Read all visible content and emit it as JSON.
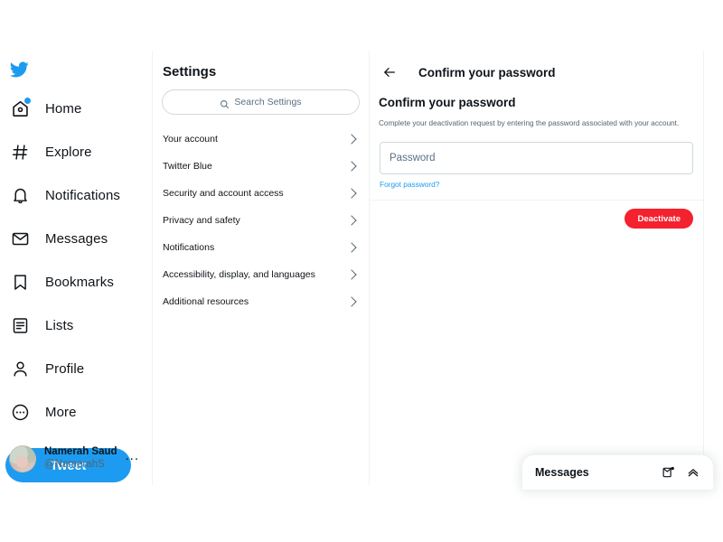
{
  "sidebar": {
    "logo_icon": "twitter-bird-icon",
    "items": [
      {
        "label": "Home",
        "icon": "home-icon",
        "badge": true
      },
      {
        "label": "Explore",
        "icon": "hashtag-icon",
        "badge": false
      },
      {
        "label": "Notifications",
        "icon": "bell-icon",
        "badge": false
      },
      {
        "label": "Messages",
        "icon": "envelope-icon",
        "badge": false
      },
      {
        "label": "Bookmarks",
        "icon": "bookmark-icon",
        "badge": false
      },
      {
        "label": "Lists",
        "icon": "list-icon",
        "badge": false
      },
      {
        "label": "Profile",
        "icon": "person-icon",
        "badge": false
      },
      {
        "label": "More",
        "icon": "more-circle-icon",
        "badge": false
      }
    ],
    "tweet_button": "Tweet",
    "account": {
      "name": "Namerah Saud Fat...",
      "handle": "@NamerahS",
      "more_label": "..."
    }
  },
  "settings": {
    "title": "Settings",
    "search_placeholder": "Search Settings",
    "items": [
      {
        "label": "Your account"
      },
      {
        "label": "Twitter Blue"
      },
      {
        "label": "Security and account access"
      },
      {
        "label": "Privacy and safety"
      },
      {
        "label": "Notifications"
      },
      {
        "label": "Accessibility, display, and languages"
      },
      {
        "label": "Additional resources"
      }
    ]
  },
  "main": {
    "header_title": "Confirm your password",
    "back_icon": "back-arrow-icon",
    "section_title": "Confirm your password",
    "description": "Complete your deactivation request by entering the password associated with your account.",
    "password_placeholder": "Password",
    "password_value": "",
    "forgot_link": "Forgot password?",
    "deactivate_button": "Deactivate"
  },
  "messages_dock": {
    "title": "Messages",
    "new_message_icon": "new-message-icon",
    "expand_icon": "chevron-up-icon"
  },
  "colors": {
    "twitter_blue": "#1d9bf0",
    "danger_red": "#f4212e",
    "text_primary": "#0f1419",
    "text_secondary": "#536471",
    "border": "#eff3f4"
  }
}
